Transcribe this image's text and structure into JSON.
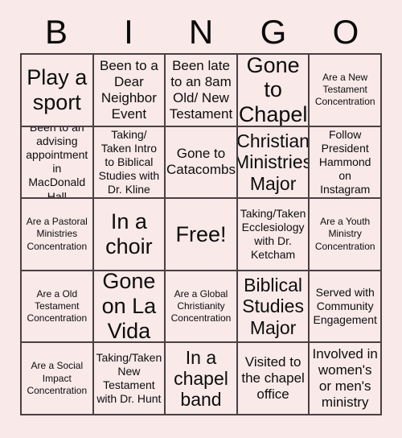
{
  "header": {
    "letters": [
      "B",
      "I",
      "N",
      "G",
      "O"
    ]
  },
  "colors": {
    "background": "#fae9e9",
    "cell_background": "#f9e9e9",
    "grid_line": "#4a4042",
    "text": "#0d0d0d"
  },
  "grid": {
    "columns": 5,
    "rows": 5,
    "free_space_index": 12,
    "cells": [
      {
        "text": "Play a sport",
        "size": "xl"
      },
      {
        "text": "Been to a Dear Neighbor Event",
        "size": "md"
      },
      {
        "text": "Been late to an 8am Old/ New Testament",
        "size": "md"
      },
      {
        "text": "Gone to Chapel",
        "size": "xl"
      },
      {
        "text": "Are a New Testament Concentration",
        "size": "xs"
      },
      {
        "text": "Been to an advising appointment in MacDonald Hall",
        "size": "sm"
      },
      {
        "text": "Taking/ Taken Intro to Biblical Studies with Dr. Kline",
        "size": "sm"
      },
      {
        "text": "Gone to Catacombs",
        "size": "md"
      },
      {
        "text": "Christian Ministries Major",
        "size": "lg"
      },
      {
        "text": "Follow President Hammond on Instagram",
        "size": "sm"
      },
      {
        "text": "Are a Pastoral Ministries Concentration",
        "size": "xs"
      },
      {
        "text": "In a choir",
        "size": "xl"
      },
      {
        "text": "Free!",
        "size": "xl"
      },
      {
        "text": "Taking/Taken Ecclesiology with Dr. Ketcham",
        "size": "sm"
      },
      {
        "text": "Are a Youth Ministry Concentration",
        "size": "xs"
      },
      {
        "text": "Are a Old Testament Concentration",
        "size": "xs"
      },
      {
        "text": "Gone on La Vida",
        "size": "xl"
      },
      {
        "text": "Are a Global Christianity Concentration",
        "size": "xs"
      },
      {
        "text": "Biblical Studies Major",
        "size": "lg"
      },
      {
        "text": "Served with Community Engagement",
        "size": "sm"
      },
      {
        "text": "Are a Social Impact Concentration",
        "size": "xs"
      },
      {
        "text": "Taking/Taken New Testament with Dr. Hunt",
        "size": "sm"
      },
      {
        "text": "In a chapel band",
        "size": "lg"
      },
      {
        "text": "Visited to the chapel office",
        "size": "md"
      },
      {
        "text": "Involved in women's or men's ministry",
        "size": "md"
      }
    ]
  }
}
